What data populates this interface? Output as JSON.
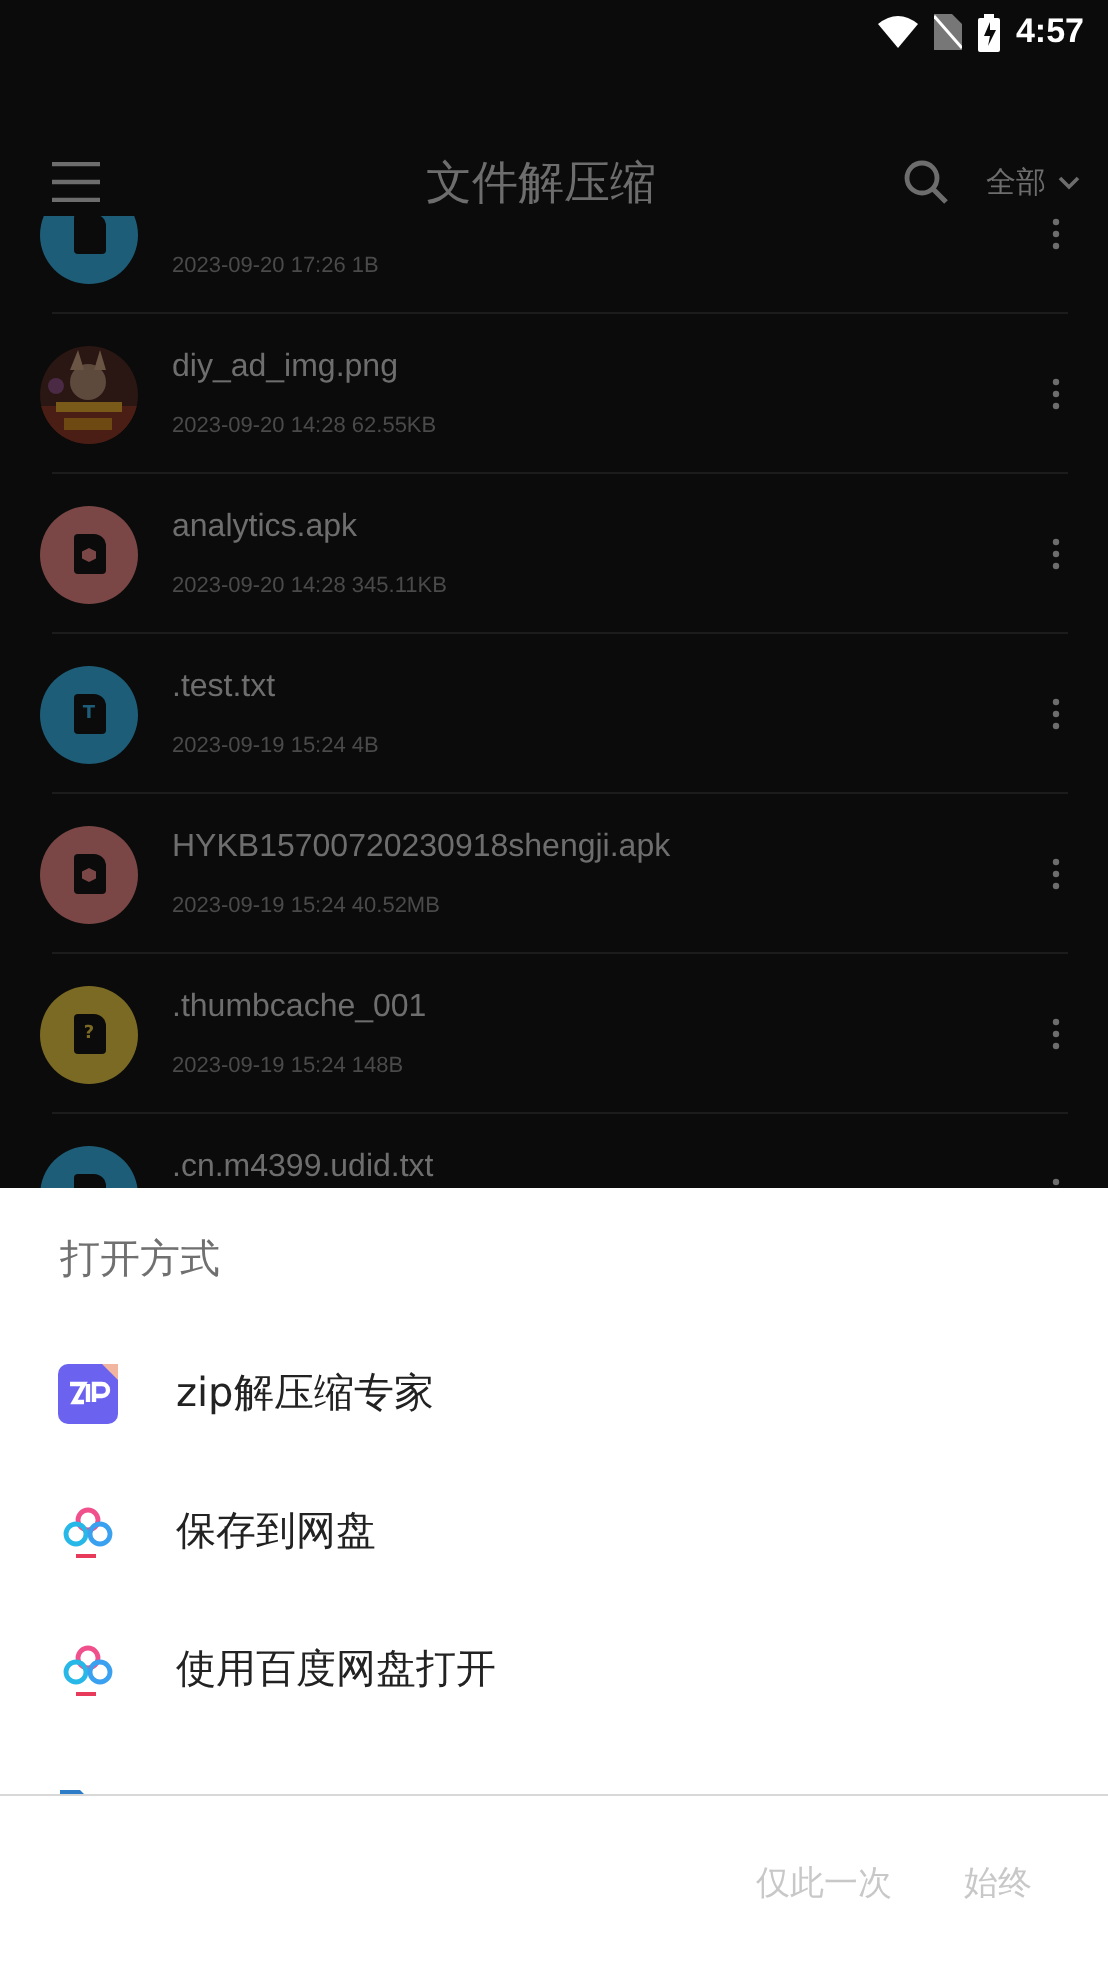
{
  "status_bar": {
    "time": "4:57"
  },
  "app_bar": {
    "title": "文件解压缩",
    "filter": "全部"
  },
  "files": [
    {
      "kind": "text",
      "meta": "2023-09-20 17:26  1B"
    },
    {
      "name": "diy_ad_img.png",
      "meta": "2023-09-20 14:28  62.55KB"
    },
    {
      "kind": "apk",
      "name": "analytics.apk",
      "meta": "2023-09-20 14:28  345.11KB"
    },
    {
      "kind": "text",
      "glyph": "T",
      "name": ".test.txt",
      "meta": "2023-09-19 15:24  4B"
    },
    {
      "kind": "apk",
      "name": "HYKB15700720230918shengji.apk",
      "meta": "2023-09-19 15:24  40.52MB"
    },
    {
      "kind": "unknown",
      "glyph": "?",
      "name": ".thumbcache_001",
      "meta": "2023-09-19 15:24  148B"
    },
    {
      "kind": "text",
      "name": ".cn.m4399.udid.txt"
    }
  ],
  "sheet": {
    "title": "打开方式",
    "apps": [
      {
        "kind": "zip",
        "label": "zip解压缩专家"
      },
      {
        "kind": "cloud",
        "label": "保存到网盘"
      },
      {
        "kind": "cloud",
        "label": "使用百度网盘打开"
      },
      {
        "kind": "folder"
      }
    ],
    "buttons": [
      {
        "label": "仅此一次",
        "disabled": true
      },
      {
        "label": "始终",
        "disabled": true
      }
    ]
  }
}
